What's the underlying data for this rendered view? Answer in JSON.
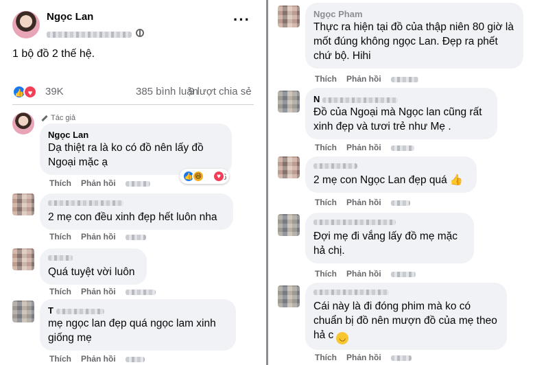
{
  "post": {
    "author": "Ngọc Lan",
    "caption": "1 bộ đồ 2 thế hệ.",
    "more_icon": "more-dots-icon",
    "reactions_count": "39K",
    "comments_count": "385 bình luận",
    "shares_count": "9 lượt chia sẻ",
    "reaction_icons": [
      "like-icon",
      "love-icon"
    ]
  },
  "labels": {
    "author_badge": "Tác giả",
    "like": "Thích",
    "reply": "Phản hồi"
  },
  "left_comments": [
    {
      "name": "Ngọc Lan",
      "text": "Dạ thiệt ra là ko có đồ nên lấy đồ Ngoại mặc ạ",
      "reaction_count": "76"
    },
    {
      "name": "",
      "text": "2 mẹ con đều xinh đẹp hết luôn nha"
    },
    {
      "name": "",
      "text": "Quá tuyệt vời luôn"
    },
    {
      "name": "T",
      "text": "mẹ ngọc lan đẹp quá ngọc lam xinh giống mẹ"
    }
  ],
  "right_comments": [
    {
      "name": "Ngọc Pham",
      "text": "Thực ra hiện tại đồ của thập niên 80 giờ là mốt đúng không ngọc Lan. Đẹp ra phết chứ bộ. Hihi"
    },
    {
      "name": "N",
      "text": "Đồ của Ngoại mà Ngọc lan cũng rất xinh đẹp và tươi trẻ như Mẹ ."
    },
    {
      "name": "",
      "text": "2 mẹ con Ngọc Lan đẹp quá"
    },
    {
      "name": "",
      "text": "Đợi mẹ đi vắng lấy đồ mẹ mặc hả chị."
    },
    {
      "name": "",
      "text": "Cái này là đi đóng phim mà ko có chuẩn bị đồ nên mượn đồ của mẹ theo hả c"
    }
  ]
}
